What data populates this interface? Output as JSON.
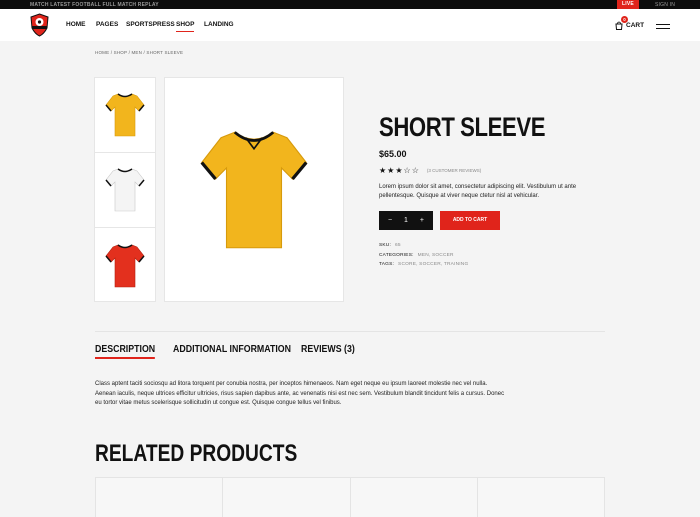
{
  "topbar": {
    "ticker": "MATCH LATEST FOOTBALL FULL MATCH REPLAY",
    "live": "LIVE",
    "signin": "SIGN IN"
  },
  "header": {
    "logo_name": "shield-logo",
    "nav": [
      {
        "label": "HOME"
      },
      {
        "label": "PAGES"
      },
      {
        "label": "SPORTSPRESS"
      },
      {
        "label": "SHOP",
        "active": true
      },
      {
        "label": "LANDING"
      }
    ],
    "cart_label": "CART",
    "cart_count": "0"
  },
  "breadcrumb": "HOME / SHOP / MEN / SHORT SLEEVE",
  "product": {
    "thumbnails": [
      {
        "color": "#f2b51d",
        "trim": "#111111"
      },
      {
        "color": "#f2f2f2",
        "trim": "#111111"
      },
      {
        "color": "#e3301e",
        "trim": "#111111"
      }
    ],
    "main_image_color": "#f2b51d",
    "title": "SHORT SLEEVE",
    "price": "$65.00",
    "rating": {
      "stars": "★★★☆☆",
      "value": 3,
      "out_of": 5,
      "reviews_text": "(3 CUSTOMER REVIEWS)"
    },
    "description": "Lorem ipsum dolor sit amet, consectetur adipiscing elit. Vestibulum ut ante pellentesque. Quisque at viver neque ctetur nisl at vehicular.",
    "quantity": "1",
    "qty_minus": "−",
    "qty_plus": "+",
    "add_to_cart": "ADD TO CART",
    "meta": {
      "sku_label": "SKU:",
      "sku": "65",
      "categories_label": "CATEGORIES:",
      "categories": "MEN, SOCCER",
      "tags_label": "TAGS:",
      "tags": "SCORE, SOCCER, TRAINING"
    }
  },
  "tabs": [
    {
      "label": "DESCRIPTION",
      "active": true
    },
    {
      "label": "ADDITIONAL INFORMATION"
    },
    {
      "label": "REVIEWS (3)"
    }
  ],
  "tab_content": "Class aptent taciti sociosqu ad litora torquent per conubia nostra, per inceptos himenaeos. Nam eget neque eu ipsum laoreet molestie nec vel nulla. Aenean iaculis, neque ultrices efficitur ultricies, risus sapien dapibus ante, ac venenatis nisi est nec sem. Vestibulum blandit tincidunt felis a cursus. Donec eu tortor vitae metus scelerisque sollicitudin ut congue est. Quisque congue tellus vel finibus.",
  "related_title": "RELATED PRODUCTS",
  "colors": {
    "accent": "#e0241b",
    "dark": "#111111"
  }
}
